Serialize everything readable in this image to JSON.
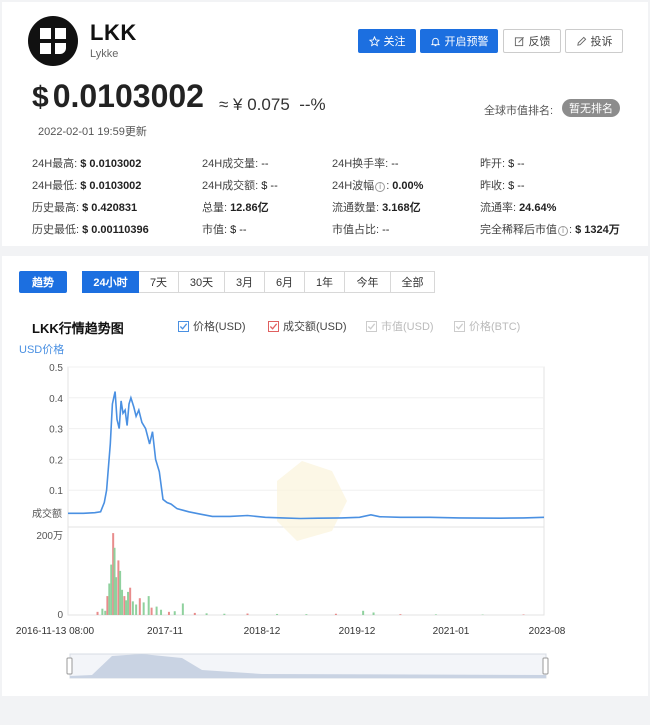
{
  "coin": {
    "symbol": "LKK",
    "name": "Lykke"
  },
  "actions": {
    "follow": "关注",
    "alert": "开启预警",
    "feedback": "反馈",
    "complaint": "投诉"
  },
  "price": {
    "usd": "0.0103002",
    "cny": "≈ ¥ 0.075",
    "change": "--%",
    "updated": "2022-02-01 19:59更新"
  },
  "rank": {
    "label": "全球市值排名:",
    "value": "暂无排名"
  },
  "stats": [
    {
      "label": "24H最高:",
      "value": "$ 0.0103002"
    },
    {
      "label": "24H成交量:",
      "value": "--"
    },
    {
      "label": "24H换手率:",
      "value": "--"
    },
    {
      "label": "昨开:",
      "value": "$ --"
    },
    {
      "label": "24H最低:",
      "value": "$ 0.0103002"
    },
    {
      "label": "24H成交额:",
      "value": "$ --"
    },
    {
      "label": "24H波幅",
      "value": "0.00%"
    },
    {
      "label": "昨收:",
      "value": "$ --"
    },
    {
      "label": "历史最高:",
      "value": "$ 0.420831"
    },
    {
      "label": "总量:",
      "value": "12.86亿"
    },
    {
      "label": "流通数量:",
      "value": "3.168亿"
    },
    {
      "label": "流通率:",
      "value": "24.64%"
    },
    {
      "label": "历史最低:",
      "value": "$ 0.00110396"
    },
    {
      "label": "市值:",
      "value": "$ --"
    },
    {
      "label": "市值占比:",
      "value": "--"
    },
    {
      "label": "完全稀释后市值",
      "value": "$ 1324万"
    }
  ],
  "tabs": {
    "trend": "趋势",
    "ranges": [
      "24小时",
      "7天",
      "30天",
      "3月",
      "6月",
      "1年",
      "今年",
      "全部"
    ],
    "active_range": "24小时"
  },
  "chart": {
    "title": "LKK行情趋势图",
    "legend": [
      {
        "label": "价格(USD)",
        "color": "#4a90e2",
        "checked": true
      },
      {
        "label": "成交额(USD)",
        "color": "#e06060",
        "checked": true
      },
      {
        "label": "市值(USD)",
        "color": "#cccccc",
        "checked": false
      },
      {
        "label": "价格(BTC)",
        "color": "#cccccc",
        "checked": false
      }
    ]
  },
  "chart_data": {
    "type": "line",
    "title": "",
    "ylabel": "USD价格",
    "ylim": [
      0,
      0.5
    ],
    "yticks": [
      "0.5",
      "0.4",
      "0.3",
      "0.2",
      "0.1"
    ],
    "volume_label": "成交额",
    "volume_ticks": [
      "200万",
      "0"
    ],
    "x_ticks": [
      "2016-11-13 08:00",
      "2017-11",
      "2018-12",
      "2019-12",
      "2021-01",
      "2023-08"
    ],
    "x_domain": [
      "2016-11-13",
      "2023-08-15"
    ],
    "series": [
      {
        "values": [
          [
            "2016-11-13",
            0.025
          ],
          [
            "2017-02-01",
            0.025
          ],
          [
            "2017-04-01",
            0.027
          ],
          [
            "2017-05-01",
            0.03
          ],
          [
            "2017-05-20",
            0.06
          ],
          [
            "2017-06-01",
            0.1
          ],
          [
            "2017-06-20",
            0.25
          ],
          [
            "2017-07-01",
            0.38
          ],
          [
            "2017-07-15",
            0.42
          ],
          [
            "2017-07-25",
            0.33
          ],
          [
            "2017-08-05",
            0.3
          ],
          [
            "2017-08-15",
            0.39
          ],
          [
            "2017-08-25",
            0.35
          ],
          [
            "2017-09-05",
            0.36
          ],
          [
            "2017-09-15",
            0.31
          ],
          [
            "2017-09-25",
            0.38
          ],
          [
            "2017-10-05",
            0.4
          ],
          [
            "2017-10-20",
            0.37
          ],
          [
            "2017-11-01",
            0.34
          ],
          [
            "2017-11-15",
            0.36
          ],
          [
            "2017-12-01",
            0.32
          ],
          [
            "2017-12-20",
            0.3
          ],
          [
            "2018-01-10",
            0.25
          ],
          [
            "2018-01-25",
            0.29
          ],
          [
            "2018-02-10",
            0.2
          ],
          [
            "2018-03-01",
            0.16
          ],
          [
            "2018-03-20",
            0.07
          ],
          [
            "2018-04-10",
            0.06
          ],
          [
            "2018-05-01",
            0.055
          ],
          [
            "2018-06-01",
            0.04
          ],
          [
            "2018-07-01",
            0.035
          ],
          [
            "2018-08-01",
            0.03
          ],
          [
            "2018-10-01",
            0.022
          ],
          [
            "2018-12-01",
            0.015
          ],
          [
            "2019-03-01",
            0.015
          ],
          [
            "2019-06-01",
            0.018
          ],
          [
            "2019-09-01",
            0.012
          ],
          [
            "2019-12-01",
            0.01
          ],
          [
            "2020-03-01",
            0.008
          ],
          [
            "2020-06-01",
            0.009
          ],
          [
            "2020-10-01",
            0.01
          ],
          [
            "2021-01-01",
            0.012
          ],
          [
            "2021-03-01",
            0.02
          ],
          [
            "2021-04-15",
            0.014
          ],
          [
            "2021-08-01",
            0.012
          ],
          [
            "2022-01-01",
            0.012
          ],
          [
            "2022-06-01",
            0.01
          ],
          [
            "2023-01-01",
            0.009
          ],
          [
            "2023-05-01",
            0.01
          ],
          [
            "2023-08-15",
            0.012
          ]
        ]
      }
    ],
    "volume": {
      "max": 4000000,
      "values": [
        [
          "2017-04-15",
          150000
        ],
        [
          "2017-05-10",
          300000
        ],
        [
          "2017-05-25",
          200000
        ],
        [
          "2017-06-05",
          900000
        ],
        [
          "2017-06-15",
          1500000
        ],
        [
          "2017-06-25",
          2400000
        ],
        [
          "2017-07-05",
          3900000
        ],
        [
          "2017-07-12",
          3200000
        ],
        [
          "2017-07-20",
          1800000
        ],
        [
          "2017-08-01",
          2600000
        ],
        [
          "2017-08-10",
          2100000
        ],
        [
          "2017-08-20",
          1200000
        ],
        [
          "2017-09-01",
          900000
        ],
        [
          "2017-09-10",
          700000
        ],
        [
          "2017-09-20",
          1100000
        ],
        [
          "2017-10-01",
          1300000
        ],
        [
          "2017-10-15",
          650000
        ],
        [
          "2017-11-01",
          500000
        ],
        [
          "2017-11-20",
          800000
        ],
        [
          "2017-12-10",
          600000
        ],
        [
          "2018-01-05",
          900000
        ],
        [
          "2018-01-20",
          350000
        ],
        [
          "2018-02-15",
          400000
        ],
        [
          "2018-03-10",
          250000
        ],
        [
          "2018-04-20",
          150000
        ],
        [
          "2018-05-20",
          180000
        ],
        [
          "2018-07-01",
          550000
        ],
        [
          "2018-09-01",
          100000
        ],
        [
          "2018-11-01",
          80000
        ],
        [
          "2019-02-01",
          60000
        ],
        [
          "2019-06-01",
          70000
        ],
        [
          "2019-11-01",
          50000
        ],
        [
          "2020-04-01",
          40000
        ],
        [
          "2020-09-01",
          60000
        ],
        [
          "2021-01-20",
          200000
        ],
        [
          "2021-03-15",
          120000
        ],
        [
          "2021-08-01",
          40000
        ],
        [
          "2022-02-01",
          30000
        ],
        [
          "2022-10-01",
          20000
        ],
        [
          "2023-05-01",
          25000
        ]
      ]
    }
  }
}
